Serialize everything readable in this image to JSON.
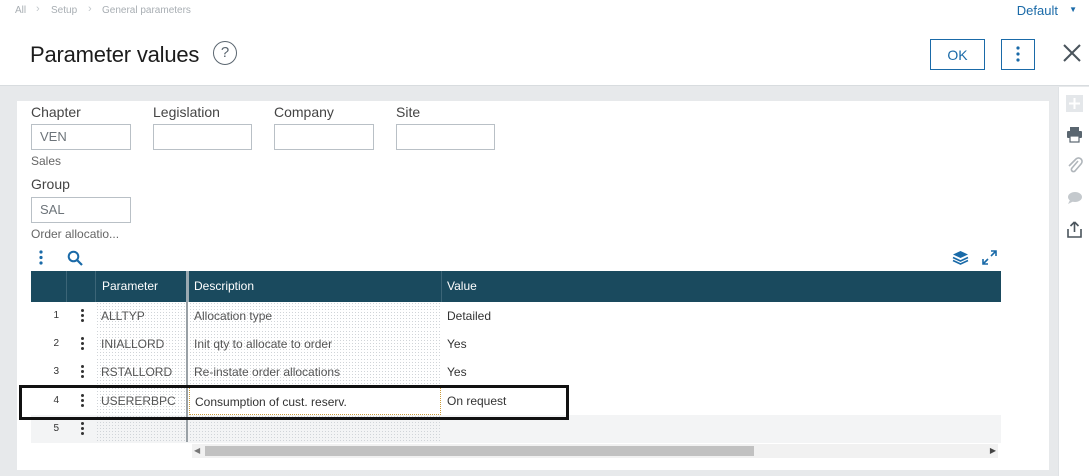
{
  "breadcrumb": {
    "items": [
      "All",
      "Setup",
      "General parameters"
    ]
  },
  "folder_selector": {
    "value": "Default"
  },
  "header": {
    "title": "Parameter values",
    "help_glyph": "?",
    "ok_label": "OK"
  },
  "form": {
    "chapter": {
      "label": "Chapter",
      "value": "VEN",
      "description": "Sales"
    },
    "legislation": {
      "label": "Legislation",
      "value": ""
    },
    "company": {
      "label": "Company",
      "value": ""
    },
    "site": {
      "label": "Site",
      "value": ""
    },
    "group": {
      "label": "Group",
      "value": "SAL",
      "description": "Order allocatio..."
    }
  },
  "grid": {
    "columns": [
      "Parameter",
      "Description",
      "Value"
    ],
    "rows": [
      {
        "num": "1",
        "parameter": "ALLTYP",
        "description": "Allocation type",
        "value": "Detailed"
      },
      {
        "num": "2",
        "parameter": "INIALLORD",
        "description": "Init qty to allocate to order",
        "value": "Yes"
      },
      {
        "num": "3",
        "parameter": "RSTALLORD",
        "description": "Re-instate order allocations",
        "value": "Yes"
      },
      {
        "num": "4",
        "parameter": "USERERBPC",
        "description": "Consumption of cust. reserv.",
        "value": "On request"
      },
      {
        "num": "5",
        "parameter": "",
        "description": "",
        "value": ""
      }
    ],
    "highlighted_row": "4"
  },
  "icons": {
    "help": "help-icon",
    "more": "more-vertical-icon",
    "close": "close-icon",
    "rail": [
      "add-icon",
      "print-icon",
      "attachment-icon",
      "comment-icon",
      "share-icon"
    ],
    "grid_tools": [
      "more-vertical-icon",
      "search-icon",
      "layers-icon",
      "expand-icon"
    ]
  },
  "colors": {
    "accent": "#1a6aa8",
    "grid_header": "#1a4a5e",
    "highlight": "#111111"
  }
}
